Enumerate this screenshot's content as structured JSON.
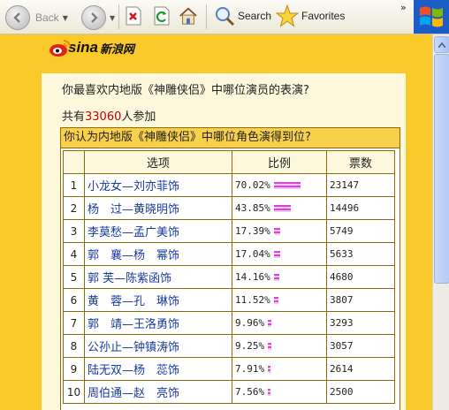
{
  "toolbar": {
    "back_label": "Back",
    "search_label": "Search",
    "favorites_label": "Favorites",
    "more_label": "»",
    "icons": [
      "back-icon",
      "forward-icon",
      "stop-icon",
      "refresh-icon",
      "home-icon",
      "search-icon",
      "favorites-star-icon",
      "windows-logo-icon"
    ]
  },
  "logo": {
    "brand": "sina",
    "brand_cn": "新浪网"
  },
  "poll": {
    "question": "你最喜欢内地版《神雕侠侣》中哪位演员的表演?",
    "participants_prefix": "共有",
    "participants_count": "33060",
    "participants_suffix": "人参加",
    "box_title": "你认为内地版《神雕侠侣》中哪位角色演得到位?",
    "headers": {
      "option": "选项",
      "ratio": "比例",
      "votes": "票数"
    },
    "bar_color": "#d24ad2",
    "rows": [
      {
        "no": "1",
        "option": "小龙女—刘亦菲饰",
        "pct": "70.02%",
        "pct_value": 70.02,
        "votes": "23147"
      },
      {
        "no": "2",
        "option": "杨　过—黄晓明饰",
        "pct": "43.85%",
        "pct_value": 43.85,
        "votes": "14496"
      },
      {
        "no": "3",
        "option": "李莫愁—孟广美饰",
        "pct": "17.39%",
        "pct_value": 17.39,
        "votes": "5749"
      },
      {
        "no": "4",
        "option": "郭　襄—杨　幂饰",
        "pct": "17.04%",
        "pct_value": 17.04,
        "votes": "5633"
      },
      {
        "no": "5",
        "option": "郭 芙—陈紫函饰",
        "pct": "14.16%",
        "pct_value": 14.16,
        "votes": "4680"
      },
      {
        "no": "6",
        "option": "黄　蓉—孔　琳饰",
        "pct": "11.52%",
        "pct_value": 11.52,
        "votes": "3807"
      },
      {
        "no": "7",
        "option": "郭　靖—王洛勇饰",
        "pct": "9.96%",
        "pct_value": 9.96,
        "votes": "3293"
      },
      {
        "no": "8",
        "option": "公孙止—钟镇涛饰",
        "pct": "9.25%",
        "pct_value": 9.25,
        "votes": "3057"
      },
      {
        "no": "9",
        "option": "陆无双—杨　蕊饰",
        "pct": "7.91%",
        "pct_value": 7.91,
        "votes": "2614"
      },
      {
        "no": "10",
        "option": "周伯通—赵　亮饰",
        "pct": "7.56%",
        "pct_value": 7.56,
        "votes": "2500"
      }
    ]
  }
}
